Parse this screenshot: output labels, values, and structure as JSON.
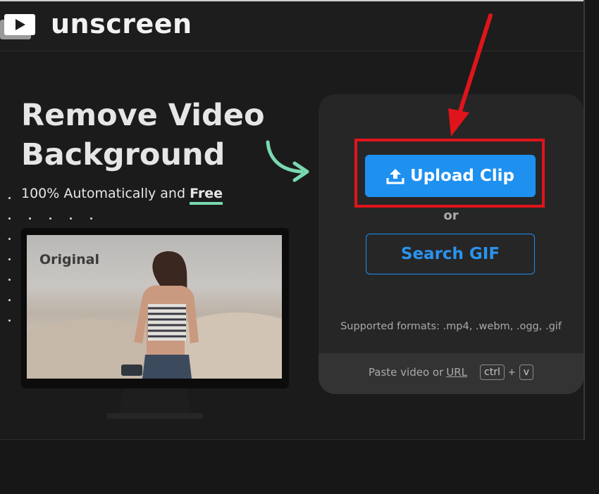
{
  "header": {
    "brand": "unscreen",
    "logo_icon": "play-window-icon"
  },
  "hero": {
    "title_line1": "Remove Video",
    "title_line2": "Background",
    "subtitle_prefix": "100% Automatically and ",
    "subtitle_free": "Free"
  },
  "preview": {
    "label": "Original"
  },
  "upload_panel": {
    "upload_button": "Upload Clip",
    "upload_icon": "upload-icon",
    "or": "or",
    "search_button": "Search GIF",
    "formats": "Supported formats: .mp4, .webm, .ogg, .gif",
    "paste_prefix": "Paste video or",
    "paste_url": "URL",
    "key_ctrl": "ctrl",
    "key_plus": "+",
    "key_v": "v"
  },
  "colors": {
    "accent_blue": "#1e90f0",
    "highlight_red": "#e0141b",
    "arrow_green": "#79d9b1",
    "background": "#1b1b1b"
  }
}
